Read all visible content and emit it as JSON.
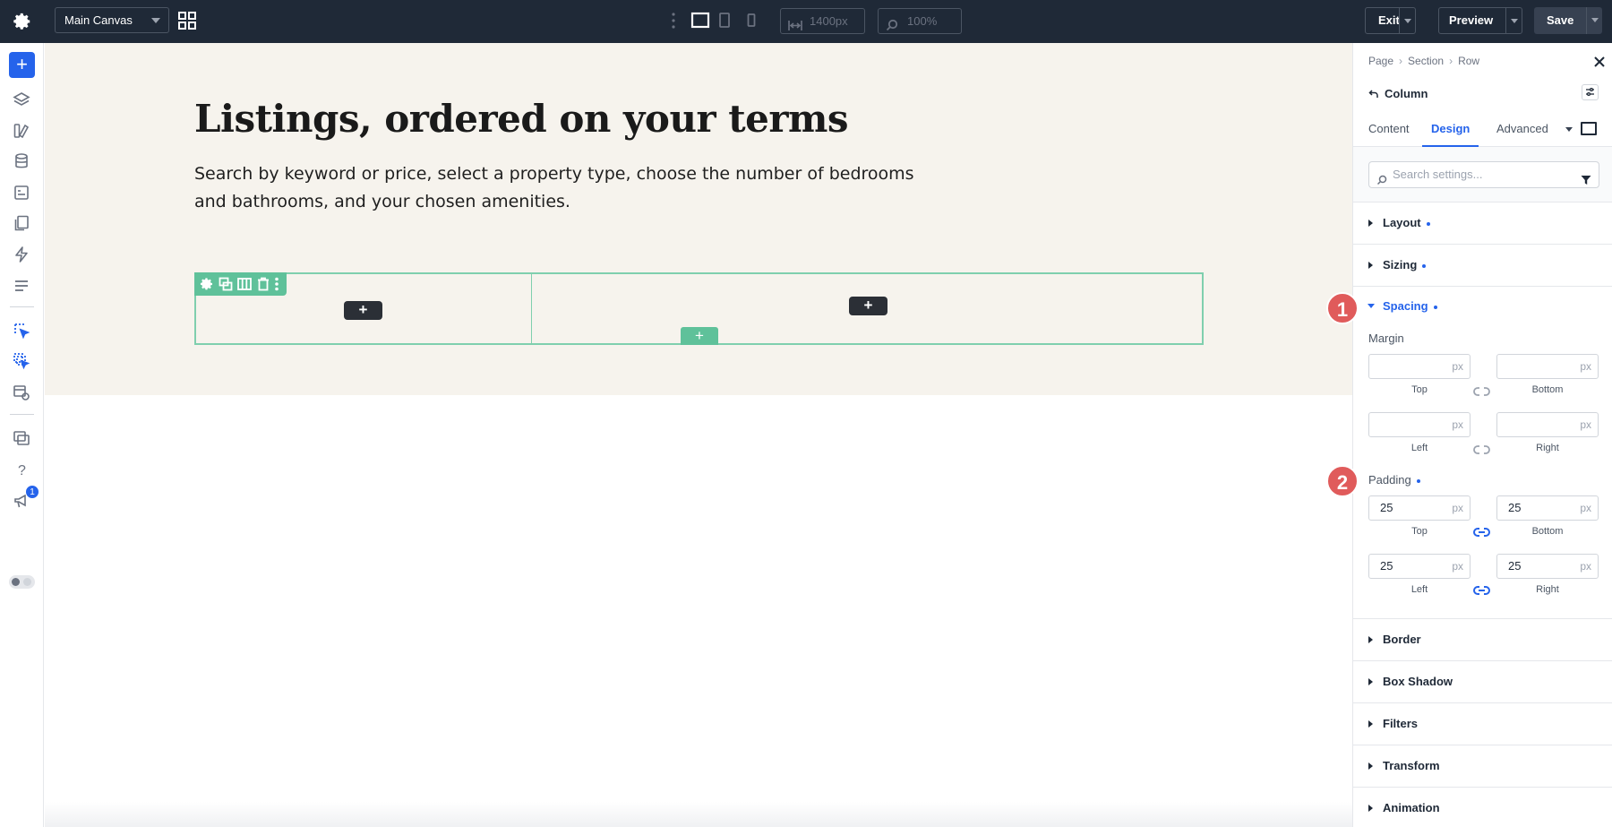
{
  "topbar": {
    "canvas_select": "Main Canvas",
    "width_value": "1400px",
    "zoom_value": "100%",
    "exit_label": "Exit",
    "preview_label": "Preview",
    "save_label": "Save"
  },
  "leftbar": {
    "notification_count": "1"
  },
  "canvas": {
    "heading": "Listings, ordered on your terms",
    "intro": "Search by keyword or price, select a property type, choose the number of bedrooms and bathrooms, and your chosen amenities.",
    "add_symbol": "+"
  },
  "panel": {
    "breadcrumb": [
      "Page",
      "Section",
      "Row"
    ],
    "element_title": "Column",
    "tabs": [
      "Content",
      "Design",
      "Advanced"
    ],
    "active_tab": "Design",
    "search_placeholder": "Search settings...",
    "groups_top": [
      "Layout",
      "Sizing"
    ],
    "spacing_title": "Spacing",
    "margin_label": "Margin",
    "padding_label": "Padding",
    "unit": "px",
    "margin": {
      "top": "",
      "bottom": "",
      "left": "",
      "right": ""
    },
    "padding": {
      "top": "25",
      "bottom": "25",
      "left": "25",
      "right": "25"
    },
    "side_labels": {
      "top": "Top",
      "bottom": "Bottom",
      "left": "Left",
      "right": "Right"
    },
    "groups_bottom": [
      "Border",
      "Box Shadow",
      "Filters",
      "Transform",
      "Animation"
    ]
  },
  "markers": [
    "1",
    "2"
  ],
  "colors": {
    "accent": "#2563eb",
    "topbar_bg": "#1f2937",
    "section_bg": "#f6f3ed",
    "row_outline": "#5fc19a",
    "marker": "#e05b5b"
  }
}
